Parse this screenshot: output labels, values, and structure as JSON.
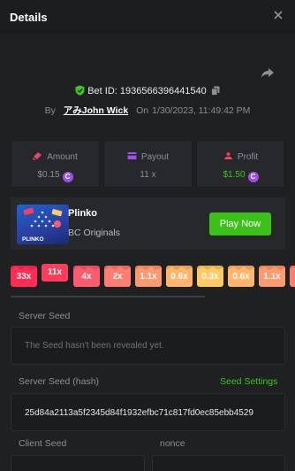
{
  "header": {
    "title": "Details"
  },
  "bet": {
    "id_text": "Bet ID: 1936566396441540",
    "by_label": "By",
    "username": "アみJohn Wick",
    "on_label": "On",
    "datetime": "1/30/2023, 11:49:42 PM"
  },
  "stats": [
    {
      "label": "Amount",
      "value": "$0.15",
      "icon": "coin-stack-icon",
      "icon_color": "#e8456b"
    },
    {
      "label": "Payout",
      "value": "11 x",
      "icon": "payout-icon",
      "icon_color": "#9b4ff0"
    },
    {
      "label": "Profit",
      "value": "$1.50",
      "icon": "profit-icon",
      "icon_color": "#e8456b"
    }
  ],
  "currency_symbol": "C",
  "game": {
    "name": "Plinko",
    "provider": "BC Originals",
    "play_label": "Play Now",
    "thumb_text": "PLINKO"
  },
  "multipliers": [
    {
      "label": "33x",
      "color": "#ff2d55"
    },
    {
      "label": "11x",
      "color": "#ff3d5a",
      "selected": true
    },
    {
      "label": "4x",
      "color": "#ff5b6e"
    },
    {
      "label": "2x",
      "color": "#ff7d72"
    },
    {
      "label": "1.1x",
      "color": "#ff9a70"
    },
    {
      "label": "0.6x",
      "color": "#ffb56b"
    },
    {
      "label": "0.3x",
      "color": "#ffc963"
    },
    {
      "label": "0.6x",
      "color": "#ffb56b"
    },
    {
      "label": "1.1x",
      "color": "#ff9a70"
    },
    {
      "label": "",
      "color": "#ff7d72"
    }
  ],
  "server_seed": {
    "label": "Server Seed",
    "placeholder": "The Seed hasn't been revealed yet."
  },
  "server_seed_hash": {
    "label": "Server Seed (hash)",
    "settings_label": "Seed Settings",
    "value": "25d84a2113a5f2345d84f1932efbc71c817fd0ec85ebb4529"
  },
  "client_seed": {
    "label": "Client Seed"
  },
  "nonce": {
    "label": "nonce"
  },
  "colors": {
    "accent_green": "#3bc117",
    "background": "#1e2022",
    "panel": "#26282b"
  }
}
